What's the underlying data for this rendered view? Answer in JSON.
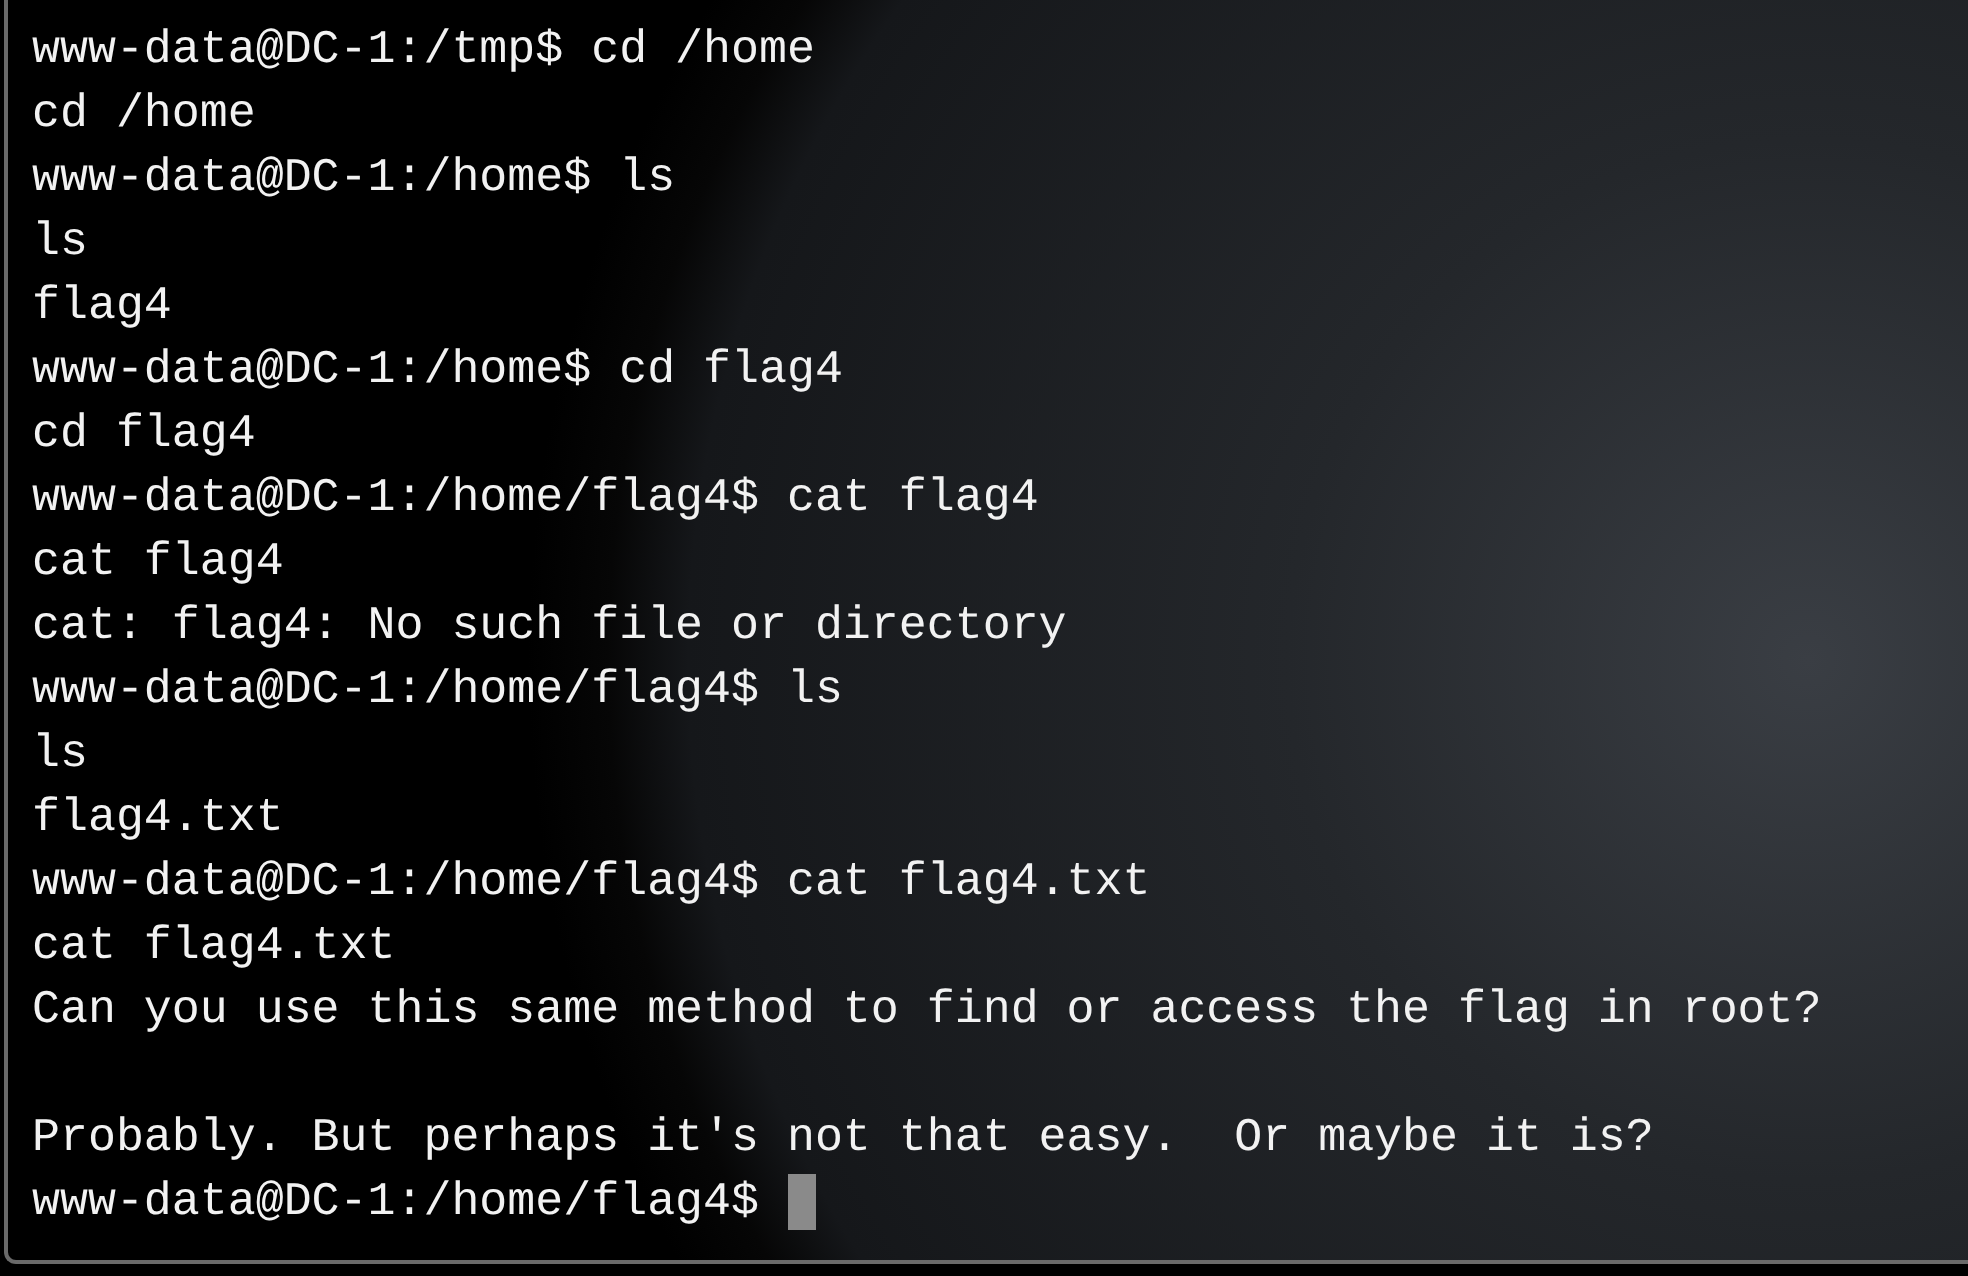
{
  "terminal": {
    "cursor": true,
    "lines": [
      {
        "kind": "text",
        "text": "www-data@DC-1:/tmp$ cd /home"
      },
      {
        "kind": "text",
        "text": "cd /home"
      },
      {
        "kind": "text",
        "text": "www-data@DC-1:/home$ ls"
      },
      {
        "kind": "text",
        "text": "ls"
      },
      {
        "kind": "text",
        "text": "flag4"
      },
      {
        "kind": "text",
        "text": "www-data@DC-1:/home$ cd flag4"
      },
      {
        "kind": "text",
        "text": "cd flag4"
      },
      {
        "kind": "text",
        "text": "www-data@DC-1:/home/flag4$ cat flag4"
      },
      {
        "kind": "text",
        "text": "cat flag4"
      },
      {
        "kind": "text",
        "text": "cat: flag4: No such file or directory"
      },
      {
        "kind": "text",
        "text": "www-data@DC-1:/home/flag4$ ls"
      },
      {
        "kind": "text",
        "text": "ls"
      },
      {
        "kind": "text",
        "text": "flag4.txt"
      },
      {
        "kind": "text",
        "text": "www-data@DC-1:/home/flag4$ cat flag4.txt"
      },
      {
        "kind": "text",
        "text": "cat flag4.txt"
      },
      {
        "kind": "text",
        "text": "Can you use this same method to find or access the flag in root?"
      },
      {
        "kind": "blank"
      },
      {
        "kind": "text",
        "text": "Probably. But perhaps it's not that easy.  Or maybe it is?"
      },
      {
        "kind": "text",
        "text": "www-data@DC-1:/home/flag4$"
      }
    ]
  }
}
